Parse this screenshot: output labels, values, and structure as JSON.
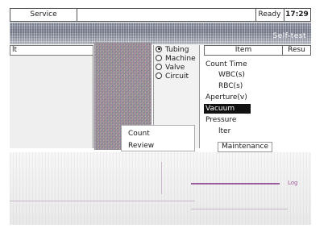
{
  "topbar": {
    "service": "Service",
    "status": "Ready",
    "time": "17:29"
  },
  "banner": {
    "mode": "Self-test"
  },
  "left_header": "lt",
  "radio": [
    {
      "label": "Tubing",
      "selected": true
    },
    {
      "label": "Machine",
      "selected": false
    },
    {
      "label": "Valve",
      "selected": false
    },
    {
      "label": "Circuit",
      "selected": false
    }
  ],
  "table": {
    "col_item": "Item",
    "col_result": "Resu",
    "rows": [
      "Count Time",
      "WBC(s)",
      "RBC(s)",
      "Aperture(v)",
      "Vacuum",
      "Pressure",
      "lter"
    ]
  },
  "menu": {
    "count": "Count",
    "review": "Review",
    "maintenance": "Maintenance"
  },
  "bottom": {
    "label_log": "Log"
  },
  "colors": {
    "accent": "#9b5c9b",
    "selected_bg": "#111111"
  }
}
